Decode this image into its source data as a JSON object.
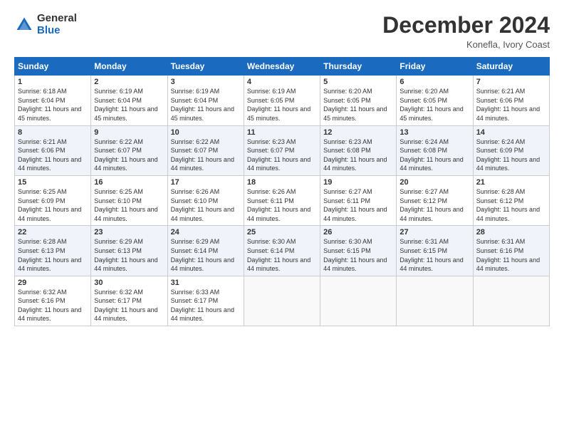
{
  "header": {
    "logo_general": "General",
    "logo_blue": "Blue",
    "month_title": "December 2024",
    "location": "Konefla, Ivory Coast"
  },
  "weekdays": [
    "Sunday",
    "Monday",
    "Tuesday",
    "Wednesday",
    "Thursday",
    "Friday",
    "Saturday"
  ],
  "weeks": [
    [
      {
        "day": "1",
        "sunrise": "Sunrise: 6:18 AM",
        "sunset": "Sunset: 6:04 PM",
        "daylight": "Daylight: 11 hours and 45 minutes."
      },
      {
        "day": "2",
        "sunrise": "Sunrise: 6:19 AM",
        "sunset": "Sunset: 6:04 PM",
        "daylight": "Daylight: 11 hours and 45 minutes."
      },
      {
        "day": "3",
        "sunrise": "Sunrise: 6:19 AM",
        "sunset": "Sunset: 6:04 PM",
        "daylight": "Daylight: 11 hours and 45 minutes."
      },
      {
        "day": "4",
        "sunrise": "Sunrise: 6:19 AM",
        "sunset": "Sunset: 6:05 PM",
        "daylight": "Daylight: 11 hours and 45 minutes."
      },
      {
        "day": "5",
        "sunrise": "Sunrise: 6:20 AM",
        "sunset": "Sunset: 6:05 PM",
        "daylight": "Daylight: 11 hours and 45 minutes."
      },
      {
        "day": "6",
        "sunrise": "Sunrise: 6:20 AM",
        "sunset": "Sunset: 6:05 PM",
        "daylight": "Daylight: 11 hours and 45 minutes."
      },
      {
        "day": "7",
        "sunrise": "Sunrise: 6:21 AM",
        "sunset": "Sunset: 6:06 PM",
        "daylight": "Daylight: 11 hours and 44 minutes."
      }
    ],
    [
      {
        "day": "8",
        "sunrise": "Sunrise: 6:21 AM",
        "sunset": "Sunset: 6:06 PM",
        "daylight": "Daylight: 11 hours and 44 minutes."
      },
      {
        "day": "9",
        "sunrise": "Sunrise: 6:22 AM",
        "sunset": "Sunset: 6:07 PM",
        "daylight": "Daylight: 11 hours and 44 minutes."
      },
      {
        "day": "10",
        "sunrise": "Sunrise: 6:22 AM",
        "sunset": "Sunset: 6:07 PM",
        "daylight": "Daylight: 11 hours and 44 minutes."
      },
      {
        "day": "11",
        "sunrise": "Sunrise: 6:23 AM",
        "sunset": "Sunset: 6:07 PM",
        "daylight": "Daylight: 11 hours and 44 minutes."
      },
      {
        "day": "12",
        "sunrise": "Sunrise: 6:23 AM",
        "sunset": "Sunset: 6:08 PM",
        "daylight": "Daylight: 11 hours and 44 minutes."
      },
      {
        "day": "13",
        "sunrise": "Sunrise: 6:24 AM",
        "sunset": "Sunset: 6:08 PM",
        "daylight": "Daylight: 11 hours and 44 minutes."
      },
      {
        "day": "14",
        "sunrise": "Sunrise: 6:24 AM",
        "sunset": "Sunset: 6:09 PM",
        "daylight": "Daylight: 11 hours and 44 minutes."
      }
    ],
    [
      {
        "day": "15",
        "sunrise": "Sunrise: 6:25 AM",
        "sunset": "Sunset: 6:09 PM",
        "daylight": "Daylight: 11 hours and 44 minutes."
      },
      {
        "day": "16",
        "sunrise": "Sunrise: 6:25 AM",
        "sunset": "Sunset: 6:10 PM",
        "daylight": "Daylight: 11 hours and 44 minutes."
      },
      {
        "day": "17",
        "sunrise": "Sunrise: 6:26 AM",
        "sunset": "Sunset: 6:10 PM",
        "daylight": "Daylight: 11 hours and 44 minutes."
      },
      {
        "day": "18",
        "sunrise": "Sunrise: 6:26 AM",
        "sunset": "Sunset: 6:11 PM",
        "daylight": "Daylight: 11 hours and 44 minutes."
      },
      {
        "day": "19",
        "sunrise": "Sunrise: 6:27 AM",
        "sunset": "Sunset: 6:11 PM",
        "daylight": "Daylight: 11 hours and 44 minutes."
      },
      {
        "day": "20",
        "sunrise": "Sunrise: 6:27 AM",
        "sunset": "Sunset: 6:12 PM",
        "daylight": "Daylight: 11 hours and 44 minutes."
      },
      {
        "day": "21",
        "sunrise": "Sunrise: 6:28 AM",
        "sunset": "Sunset: 6:12 PM",
        "daylight": "Daylight: 11 hours and 44 minutes."
      }
    ],
    [
      {
        "day": "22",
        "sunrise": "Sunrise: 6:28 AM",
        "sunset": "Sunset: 6:13 PM",
        "daylight": "Daylight: 11 hours and 44 minutes."
      },
      {
        "day": "23",
        "sunrise": "Sunrise: 6:29 AM",
        "sunset": "Sunset: 6:13 PM",
        "daylight": "Daylight: 11 hours and 44 minutes."
      },
      {
        "day": "24",
        "sunrise": "Sunrise: 6:29 AM",
        "sunset": "Sunset: 6:14 PM",
        "daylight": "Daylight: 11 hours and 44 minutes."
      },
      {
        "day": "25",
        "sunrise": "Sunrise: 6:30 AM",
        "sunset": "Sunset: 6:14 PM",
        "daylight": "Daylight: 11 hours and 44 minutes."
      },
      {
        "day": "26",
        "sunrise": "Sunrise: 6:30 AM",
        "sunset": "Sunset: 6:15 PM",
        "daylight": "Daylight: 11 hours and 44 minutes."
      },
      {
        "day": "27",
        "sunrise": "Sunrise: 6:31 AM",
        "sunset": "Sunset: 6:15 PM",
        "daylight": "Daylight: 11 hours and 44 minutes."
      },
      {
        "day": "28",
        "sunrise": "Sunrise: 6:31 AM",
        "sunset": "Sunset: 6:16 PM",
        "daylight": "Daylight: 11 hours and 44 minutes."
      }
    ],
    [
      {
        "day": "29",
        "sunrise": "Sunrise: 6:32 AM",
        "sunset": "Sunset: 6:16 PM",
        "daylight": "Daylight: 11 hours and 44 minutes."
      },
      {
        "day": "30",
        "sunrise": "Sunrise: 6:32 AM",
        "sunset": "Sunset: 6:17 PM",
        "daylight": "Daylight: 11 hours and 44 minutes."
      },
      {
        "day": "31",
        "sunrise": "Sunrise: 6:33 AM",
        "sunset": "Sunset: 6:17 PM",
        "daylight": "Daylight: 11 hours and 44 minutes."
      },
      null,
      null,
      null,
      null
    ]
  ]
}
